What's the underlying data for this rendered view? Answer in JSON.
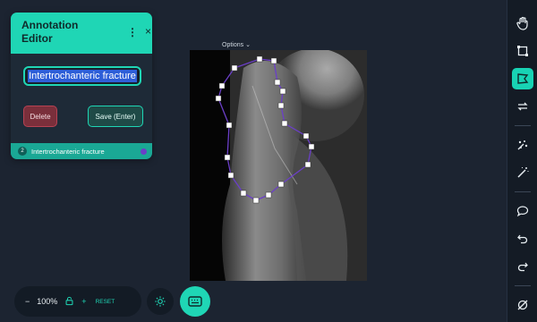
{
  "editor": {
    "title": "Annotation Editor",
    "kebab": "⋮",
    "close": "×",
    "label_value": "Intertrochanteric fracture",
    "delete_label": "Delete",
    "save_label": "Save (Enter)"
  },
  "annotations": [
    {
      "number": "2",
      "label": "Intertrochanteric fracture",
      "color": "#6b3fc8"
    }
  ],
  "canvas": {
    "options_label": "Options"
  },
  "zoom": {
    "minus": "−",
    "level": "100%",
    "plus": "+",
    "reset_label": "RESET"
  },
  "colors": {
    "accent": "#1fd6b5",
    "polygon": "#6b3fc8",
    "delete": "#7a2f3b"
  },
  "toolbar_icons": [
    "hand-icon",
    "bbox-icon",
    "polygon-icon",
    "transform-icon",
    "magic-points-icon",
    "magic-wand-icon",
    "comment-icon",
    "undo-icon",
    "redo-icon",
    "hide-icon"
  ]
}
